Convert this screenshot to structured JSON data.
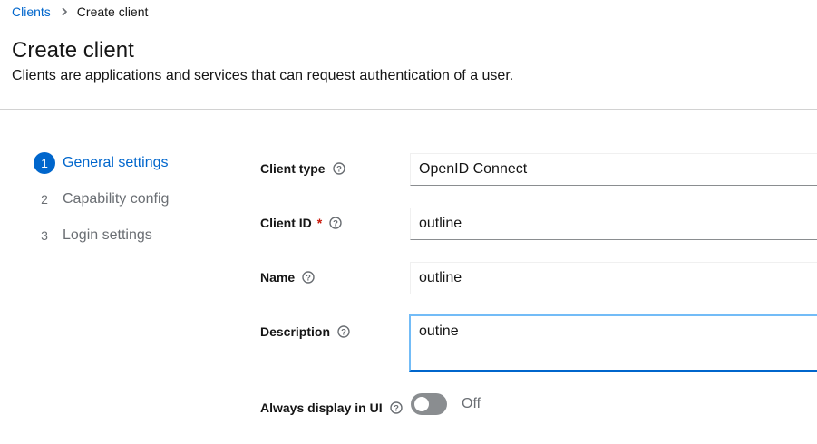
{
  "breadcrumb": {
    "parent": "Clients",
    "current": "Create client"
  },
  "header": {
    "title": "Create client",
    "description": "Clients are applications and services that can request authentication of a user."
  },
  "wizard": {
    "steps": [
      {
        "num": "1",
        "label": "General settings",
        "active": true
      },
      {
        "num": "2",
        "label": "Capability config",
        "active": false
      },
      {
        "num": "3",
        "label": "Login settings",
        "active": false
      }
    ]
  },
  "form": {
    "client_type": {
      "label": "Client type",
      "value": "OpenID Connect"
    },
    "client_id": {
      "label": "Client ID",
      "required_mark": "*",
      "value": "outline"
    },
    "name": {
      "label": "Name",
      "value": "outline"
    },
    "description": {
      "label": "Description",
      "value": "outine"
    },
    "always_display": {
      "label": "Always display in UI",
      "state_text": "Off",
      "enabled": false
    }
  },
  "colors": {
    "link": "#0066cc",
    "required": "#c9190b",
    "toggle_off": "#8a8d90"
  }
}
